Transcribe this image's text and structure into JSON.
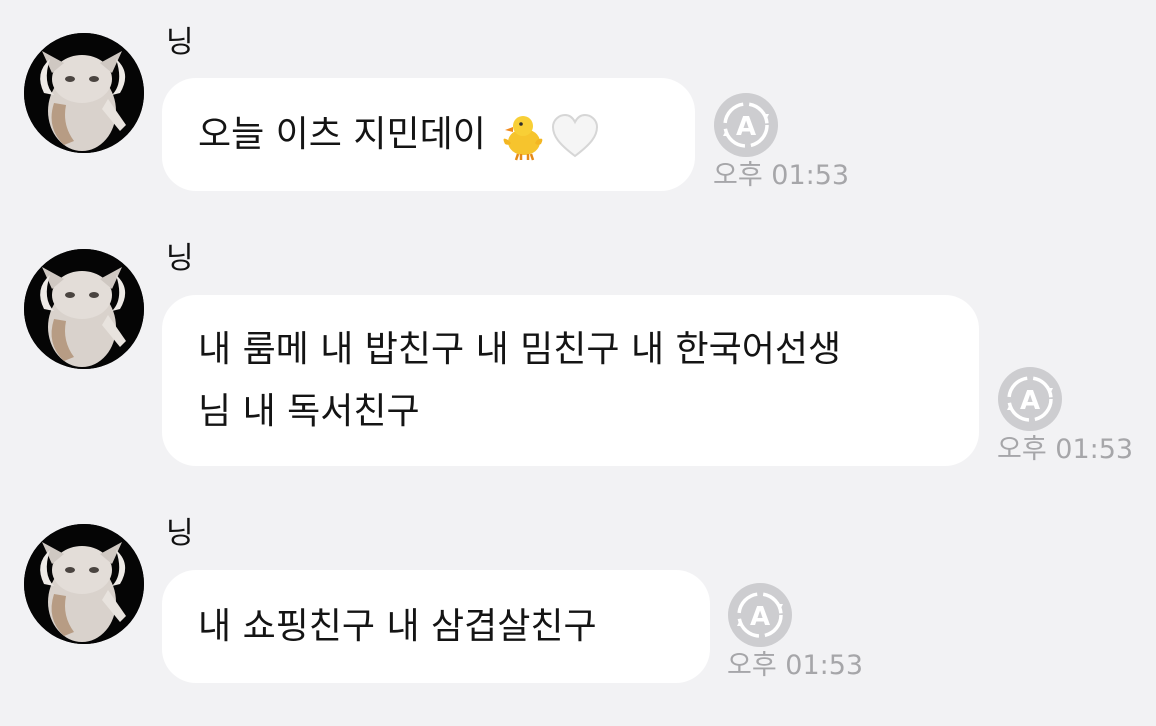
{
  "messages": [
    {
      "sender": "닝",
      "text": "오늘 이츠 지민데이",
      "emojis": [
        "chick-emoji",
        "white-heart-emoji"
      ],
      "time": "오후 01:53",
      "status_icon": "translate-a-icon"
    },
    {
      "sender": "닝",
      "lines": [
        "내 룸메 내 밥친구 내 밈친구 내 한국어선생",
        "님 내 독서친구"
      ],
      "time": "오후 01:53",
      "status_icon": "translate-a-icon"
    },
    {
      "sender": "닝",
      "text": "내 쇼핑친구 내 삼겹살친구",
      "time": "오후 01:53",
      "status_icon": "translate-a-icon"
    }
  ],
  "colors": {
    "background": "#f2f2f4",
    "bubble": "#ffffff",
    "time_text": "#a6a6a9",
    "icon": "#c9c9cc"
  }
}
